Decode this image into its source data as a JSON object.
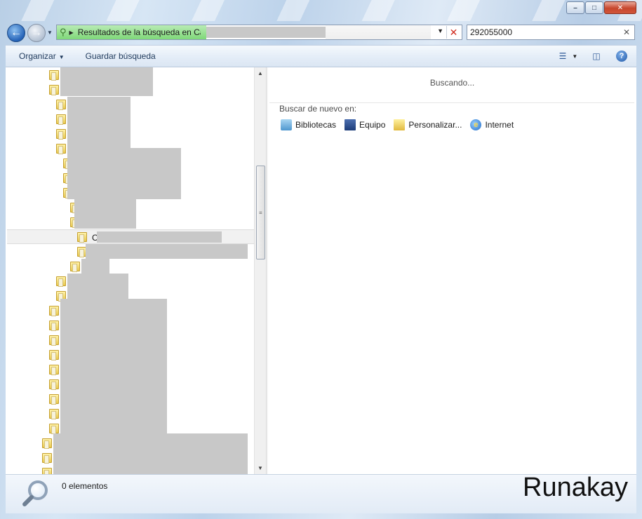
{
  "window": {
    "minimize_icon": "minimize-icon",
    "maximize_icon": "maximize-icon",
    "close_icon": "close-icon"
  },
  "navigation": {
    "back_icon": "back-arrow-icon",
    "forward_icon": "forward-arrow-icon",
    "address_text": "Resultados de la búsqueda en Car",
    "search_value": "292055000"
  },
  "toolbar": {
    "organize_label": "Organizar",
    "save_search_label": "Guardar búsqueda",
    "view_icon": "view-options-icon",
    "preview_icon": "preview-pane-icon",
    "help_icon": "help-icon"
  },
  "tree": {
    "selected_label": "C"
  },
  "results": {
    "status_text": "Buscando...",
    "search_again_label": "Buscar de nuevo en:",
    "search_again_items": [
      {
        "label": "Bibliotecas",
        "icon": "libraries-icon"
      },
      {
        "label": "Equipo",
        "icon": "computer-icon"
      },
      {
        "label": "Personalizar...",
        "icon": "custom-folder-icon"
      },
      {
        "label": "Internet",
        "icon": "internet-icon"
      }
    ]
  },
  "statusbar": {
    "item_count": "0 elementos"
  },
  "watermark": "Runakay",
  "colors": {
    "accent": "#2563b8",
    "progress": "#7fd879",
    "redaction": "#c8c8c8",
    "close_button": "#c7462d"
  }
}
